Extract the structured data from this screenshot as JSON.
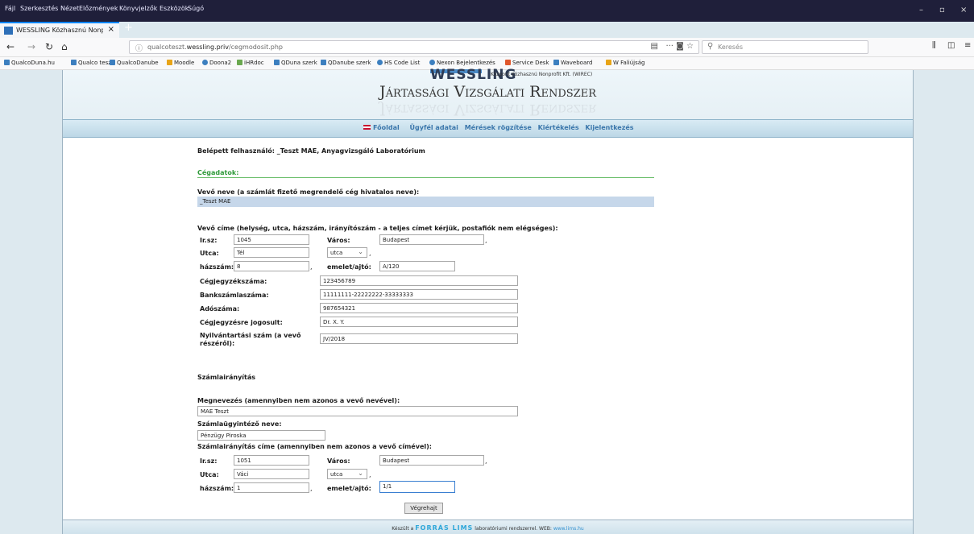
{
  "browser": {
    "menu": [
      "Fájl",
      "Szerkesztés",
      "Nézet",
      "Előzmények",
      "Könyvjelzők",
      "Eszközök",
      "Súgó"
    ],
    "tab_title": "WESSLING Közhasznú Nonprof",
    "url_prefix": "qualcoteszt.",
    "url_domain": "wessling.priv",
    "url_path": "/cegmodosit.php",
    "search_placeholder": "Keresés",
    "bookmarks": [
      "QualcoDuna.hu",
      "Qualco teszt",
      "QualcoDanube",
      "Moodle",
      "Doona2",
      "iHRdoc",
      "QDuna szerk",
      "QDanube szerk",
      "HS Code List",
      "Nexon Bejelentkezés",
      "Service Desk",
      "Waveboard",
      "W Faliújság"
    ]
  },
  "header": {
    "logo": "WESSLING",
    "company": "Központ Közhasznú Nonprofit Kft. (WIREC)",
    "system_title": "Jártassági Vizsgálati Rendszer"
  },
  "nav": {
    "items": [
      "Főoldal",
      "Ügyfél adatai",
      "Mérések rögzítése",
      "Kiértékelés",
      "Kijelentkezés"
    ]
  },
  "form": {
    "logged_in": "Belépett felhasználó: _Teszt MAE, Anyagvizsgáló Laboratórium",
    "section_company": "Cégadatok:",
    "buyer_name_label": "Vevő neve (a számlát fizető megrendelő cég hivatalos neve):",
    "buyer_name_value": "_Teszt MAE",
    "buyer_address_label": "Vevő címe (helység, utca, házszám, irányítószám - a teljes címet kérjük, postafiók nem elégséges):",
    "irsz_label": "Ir.sz:",
    "irsz_value": "1045",
    "varos_label": "Város:",
    "varos_value": "Budapest",
    "utca_label": "Utca:",
    "utca_value": "Tél",
    "utca_type": "utca",
    "hazszam_label": "házszám:",
    "hazszam_value": "8",
    "emelet_label": "emelet/ajtó:",
    "emelet_value": "A/120",
    "cegjegyzek_label": "Cégjegyzékszáma:",
    "cegjegyzek_value": "123456789",
    "bankszamla_label": "Bankszámlaszáma:",
    "bankszamla_value": "11111111-22222222-33333333",
    "adoszam_label": "Adószáma:",
    "adoszam_value": "987654321",
    "jogosult_label": "Cégjegyzésre jogosult:",
    "jogosult_value": "Dr. X. Y.",
    "nyilv_label_1": "Nyilvántartási szám (a vevő",
    "nyilv_label_2": "részéről):",
    "nyilv_value": "JV/2018",
    "section_billing": "Számlairányítás",
    "megnev_label": "Megnevezés (amennyiben nem azonos a vevő nevével):",
    "megnev_value": "MAE Teszt",
    "ugyintezo_label": "Számlaügyintéző neve:",
    "ugyintezo_value": "Pénzügy Piroska",
    "billing_addr_label": "Számlairányítás címe (amennyiben nem azonos a vevő címével):",
    "b_irsz_value": "1051",
    "b_varos_value": "Budapest",
    "b_utca_value": "Váci",
    "b_utca_type": "utca",
    "b_hazszam_value": "1",
    "b_emelet_value": "1/1",
    "submit": "Végrehajt"
  },
  "footer": {
    "prefix": "Készült a",
    "brand": "FORRÁS LIMS",
    "mid": "laboratóriumi rendszerrel.  WEB:",
    "web": "www.lims.hu"
  }
}
